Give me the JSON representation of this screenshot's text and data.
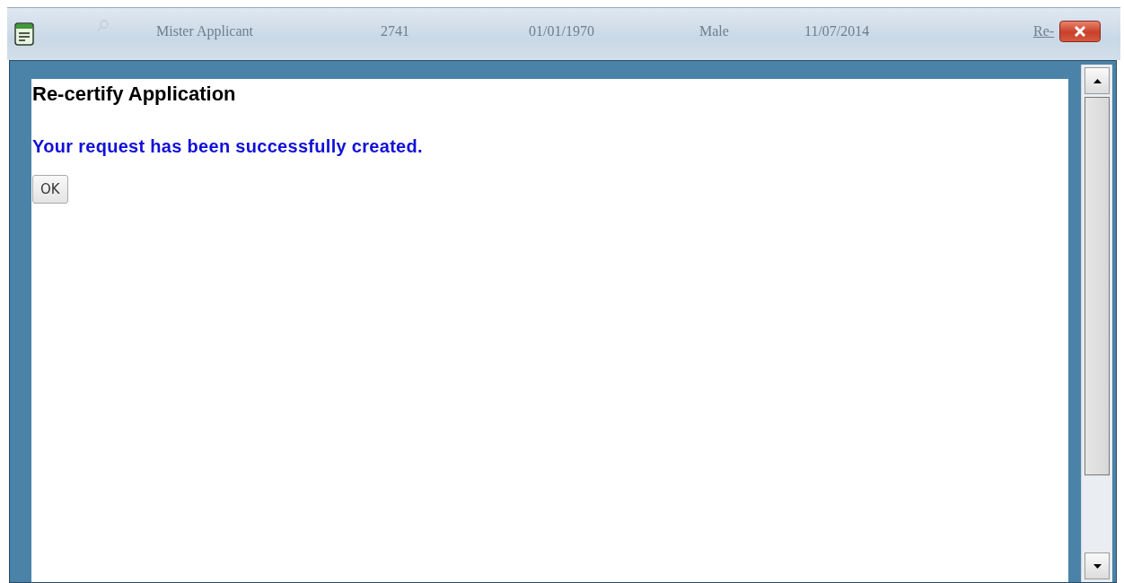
{
  "background_row": {
    "cells": [
      {
        "text": "Mister Applicant",
        "kind": "text"
      },
      {
        "text": "2741",
        "kind": "text"
      },
      {
        "text": "01/01/1970",
        "kind": "text"
      },
      {
        "text": "Male",
        "kind": "text"
      },
      {
        "text": "11/07/2014",
        "kind": "text"
      },
      {
        "text": "Re-",
        "kind": "link"
      }
    ]
  },
  "dialog": {
    "title": "Re-certify Application",
    "message": "Your request has been successfully created.",
    "buttons": [
      "OK"
    ]
  }
}
